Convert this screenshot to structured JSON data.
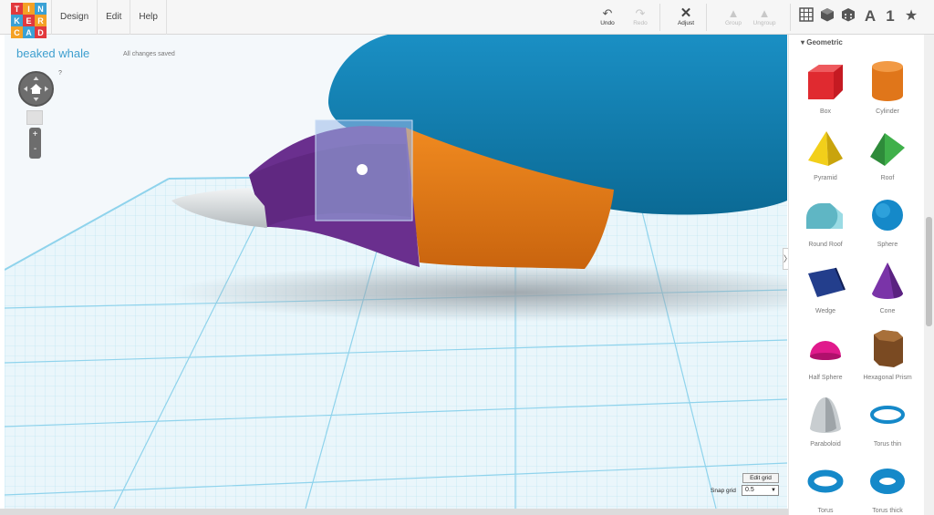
{
  "app": {
    "logo_letters": [
      "T",
      "I",
      "N",
      "K",
      "E",
      "R",
      "C",
      "A",
      "D"
    ],
    "logo_colors": [
      "#e2393d",
      "#f4a125",
      "#3aa1d5",
      "#3aa1d5",
      "#e2393d",
      "#f4a125",
      "#f4a125",
      "#3aa1d5",
      "#e2393d"
    ]
  },
  "menu": {
    "design": "Design",
    "edit": "Edit",
    "help": "Help"
  },
  "toolbar": {
    "undo": "Undo",
    "redo": "Redo",
    "adjust": "Adjust",
    "group": "Group",
    "ungroup": "Ungroup",
    "text_view": "A",
    "number_view": "1",
    "star_view": "★"
  },
  "workplane": {
    "design_name": "beaked whale",
    "save_status": "All changes saved",
    "help": "?",
    "zoom_in": "+",
    "zoom_out": "-",
    "edit_grid": "Edit grid",
    "snap_grid_label": "Snap grid",
    "snap_grid_value": "0.5"
  },
  "panel": {
    "section": "Geometric",
    "shapes": [
      {
        "label": "Box",
        "icon": "box-icon"
      },
      {
        "label": "Cylinder",
        "icon": "cylinder-icon"
      },
      {
        "label": "Pyramid",
        "icon": "pyramid-icon"
      },
      {
        "label": "Roof",
        "icon": "roof-icon"
      },
      {
        "label": "Round Roof",
        "icon": "round-roof-icon"
      },
      {
        "label": "Sphere",
        "icon": "sphere-icon"
      },
      {
        "label": "Wedge",
        "icon": "wedge-icon"
      },
      {
        "label": "Cone",
        "icon": "cone-icon"
      },
      {
        "label": "Half Sphere",
        "icon": "half-sphere-icon"
      },
      {
        "label": "Hexagonal Prism",
        "icon": "hexagonal-prism-icon"
      },
      {
        "label": "Paraboloid",
        "icon": "paraboloid-icon"
      },
      {
        "label": "Torus thin",
        "icon": "torus-thin-icon"
      },
      {
        "label": "Torus",
        "icon": "torus-icon"
      },
      {
        "label": "Torus thick",
        "icon": "torus-thick-icon"
      }
    ]
  },
  "colors": {
    "accent": "#3e9fcf",
    "whale_body": "#0f7fb0",
    "orange": "#e07c1a",
    "purple": "#6a2f8e",
    "beak": "#d8dde0",
    "grid": "#8fd3ec"
  }
}
